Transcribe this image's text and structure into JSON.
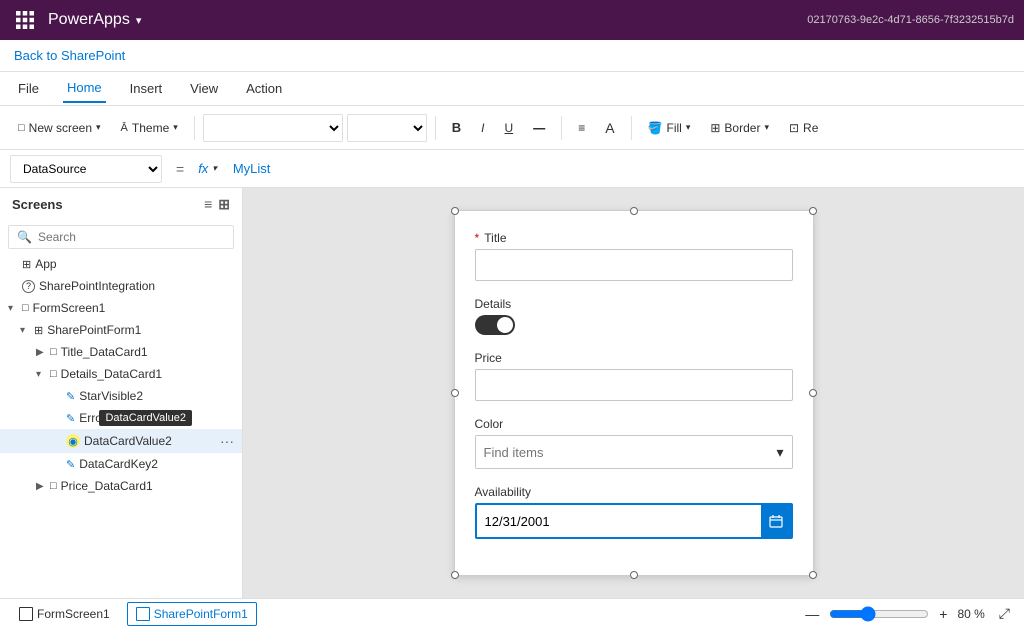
{
  "titleBar": {
    "appName": "PowerApps",
    "chevron": "▾"
  },
  "backLink": "Back to SharePoint",
  "menuBar": {
    "items": [
      {
        "id": "file",
        "label": "File"
      },
      {
        "id": "home",
        "label": "Home",
        "active": true
      },
      {
        "id": "insert",
        "label": "Insert"
      },
      {
        "id": "view",
        "label": "View"
      },
      {
        "id": "action",
        "label": "Action"
      }
    ]
  },
  "toolbar": {
    "newScreenLabel": "New screen",
    "themeLabel": "Theme",
    "fillLabel": "Fill",
    "borderLabel": "Border",
    "reLabel": "Re"
  },
  "formulaBar": {
    "property": "DataSource",
    "equalsSign": "=",
    "fxLabel": "fx",
    "formula": "MyList"
  },
  "screens": {
    "title": "Screens",
    "searchPlaceholder": "Search",
    "tree": [
      {
        "id": "app",
        "label": "App",
        "indent": 0,
        "icon": "⊞",
        "type": "app"
      },
      {
        "id": "sharepointintegration",
        "label": "SharePointIntegration",
        "indent": 0,
        "icon": "○",
        "type": "integration"
      },
      {
        "id": "formscreen1",
        "label": "FormScreen1",
        "indent": 0,
        "icon": "□",
        "type": "screen",
        "expanded": true
      },
      {
        "id": "sharepointform1",
        "label": "SharePointForm1",
        "indent": 1,
        "icon": "⊞",
        "type": "form",
        "expanded": true
      },
      {
        "id": "title_datacard1",
        "label": "Title_DataCard1",
        "indent": 2,
        "icon": "□",
        "type": "card",
        "collapsed": true
      },
      {
        "id": "details_datacard1",
        "label": "Details_DataCard1",
        "indent": 2,
        "icon": "□",
        "type": "card",
        "expanded": true
      },
      {
        "id": "starvisible2",
        "label": "StarVisible2",
        "indent": 3,
        "icon": "✎",
        "type": "control"
      },
      {
        "id": "errormessage",
        "label": "ErrorM...",
        "indent": 3,
        "icon": "✎",
        "type": "control"
      },
      {
        "id": "datacardvalue2",
        "label": "DataCardValue2",
        "indent": 3,
        "icon": "◉",
        "type": "toggle",
        "selected": true
      },
      {
        "id": "datacardkey2",
        "label": "DataCardKey2",
        "indent": 3,
        "icon": "✎",
        "type": "control"
      },
      {
        "id": "price_datacard1",
        "label": "Price_DataCard1",
        "indent": 2,
        "icon": "□",
        "type": "card",
        "collapsed": true
      }
    ]
  },
  "canvas": {
    "form": {
      "titleField": {
        "label": "Title",
        "required": true,
        "value": ""
      },
      "detailsField": {
        "label": "Details",
        "toggleOn": true
      },
      "priceField": {
        "label": "Price",
        "value": ""
      },
      "colorField": {
        "label": "Color",
        "placeholder": "Find items"
      },
      "availabilityField": {
        "label": "Availability",
        "value": "12/31/2001"
      }
    }
  },
  "tooltip": {
    "text": "DataCardValue2"
  },
  "statusBar": {
    "tabs": [
      {
        "id": "formscreen1",
        "label": "FormScreen1"
      },
      {
        "id": "sharepointform1",
        "label": "SharePointForm1"
      }
    ],
    "zoom": {
      "minus": "—",
      "plus": "+",
      "value": "80 %"
    }
  },
  "idString": "02170763-9e2c-4d71-8656-7f3232515b7d"
}
